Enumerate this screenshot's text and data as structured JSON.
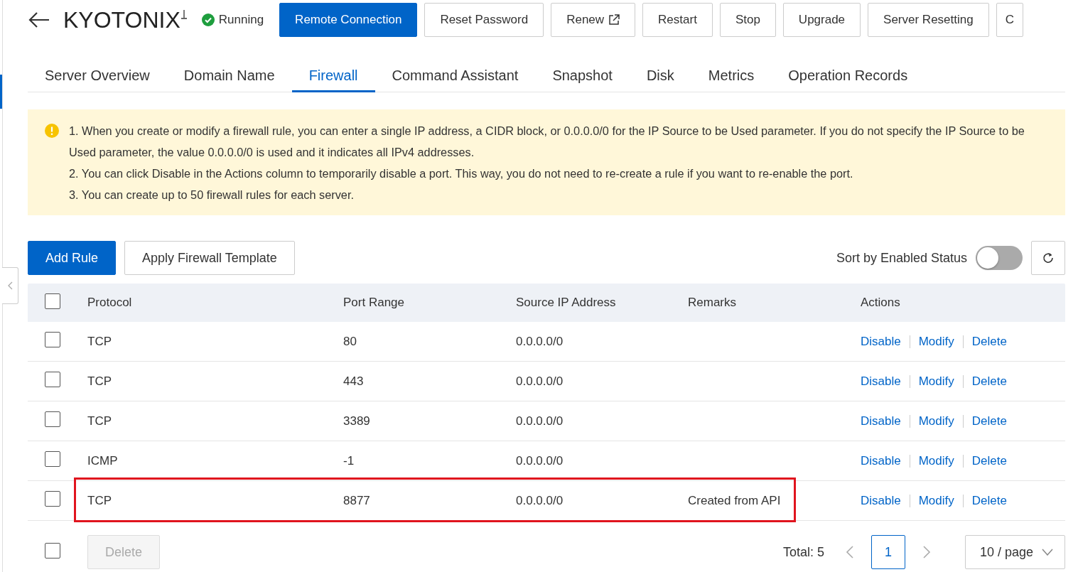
{
  "header": {
    "title": "KYOTONIX",
    "status": "Running",
    "buttons": [
      {
        "label": "Remote Connection",
        "primary": true,
        "external": false
      },
      {
        "label": "Reset Password",
        "primary": false,
        "external": false
      },
      {
        "label": "Renew",
        "primary": false,
        "external": true
      },
      {
        "label": "Restart",
        "primary": false,
        "external": false
      },
      {
        "label": "Stop",
        "primary": false,
        "external": false
      },
      {
        "label": "Upgrade",
        "primary": false,
        "external": false
      },
      {
        "label": "Server Resetting",
        "primary": false,
        "external": false
      },
      {
        "label": "C",
        "primary": false,
        "external": false
      }
    ]
  },
  "tabs": [
    {
      "label": "Server Overview",
      "selected": false
    },
    {
      "label": "Domain Name",
      "selected": false
    },
    {
      "label": "Firewall",
      "selected": true
    },
    {
      "label": "Command Assistant",
      "selected": false
    },
    {
      "label": "Snapshot",
      "selected": false
    },
    {
      "label": "Disk",
      "selected": false
    },
    {
      "label": "Metrics",
      "selected": false
    },
    {
      "label": "Operation Records",
      "selected": false
    }
  ],
  "notice": [
    "1. When you create or modify a firewall rule, you can enter a single IP address, a CIDR block, or 0.0.0.0/0 for the IP Source to be Used parameter. If you do not specify the IP Source to be Used parameter, the value 0.0.0.0/0 is used and it indicates all IPv4 addresses.",
    "2. You can click Disable in the Actions column to temporarily disable a port. This way, you do not need to re-create a rule if you want to re-enable the port.",
    "3. You can create up to 50 firewall rules for each server."
  ],
  "toolbar": {
    "add_button": "Add Rule",
    "template_button": "Apply Firewall Template",
    "sort_label": "Sort by Enabled Status",
    "sort_on": false
  },
  "table": {
    "select_all": false,
    "columns": [
      "Protocol",
      "Port Range",
      "Source IP Address",
      "Remarks",
      "Actions"
    ],
    "rows": [
      {
        "checked": false,
        "highlighted": false,
        "protocol": "TCP",
        "port": "80",
        "source": "0.0.0.0/0",
        "remarks": "",
        "actions": [
          "Disable",
          "Modify",
          "Delete"
        ]
      },
      {
        "checked": false,
        "highlighted": false,
        "protocol": "TCP",
        "port": "443",
        "source": "0.0.0.0/0",
        "remarks": "",
        "actions": [
          "Disable",
          "Modify",
          "Delete"
        ]
      },
      {
        "checked": false,
        "highlighted": false,
        "protocol": "TCP",
        "port": "3389",
        "source": "0.0.0.0/0",
        "remarks": "",
        "actions": [
          "Disable",
          "Modify",
          "Delete"
        ]
      },
      {
        "checked": false,
        "highlighted": false,
        "protocol": "ICMP",
        "port": "-1",
        "source": "0.0.0.0/0",
        "remarks": "",
        "actions": [
          "Disable",
          "Modify",
          "Delete"
        ]
      },
      {
        "checked": false,
        "highlighted": true,
        "protocol": "TCP",
        "port": "8877",
        "source": "0.0.0.0/0",
        "remarks": "Created from API",
        "actions": [
          "Disable",
          "Modify",
          "Delete"
        ]
      }
    ]
  },
  "footer": {
    "select_all": false,
    "delete_button": "Delete",
    "delete_disabled": true,
    "total": "Total: 5",
    "pages": [
      {
        "label": "1",
        "selected": true
      }
    ],
    "page_size": "10 / page"
  }
}
